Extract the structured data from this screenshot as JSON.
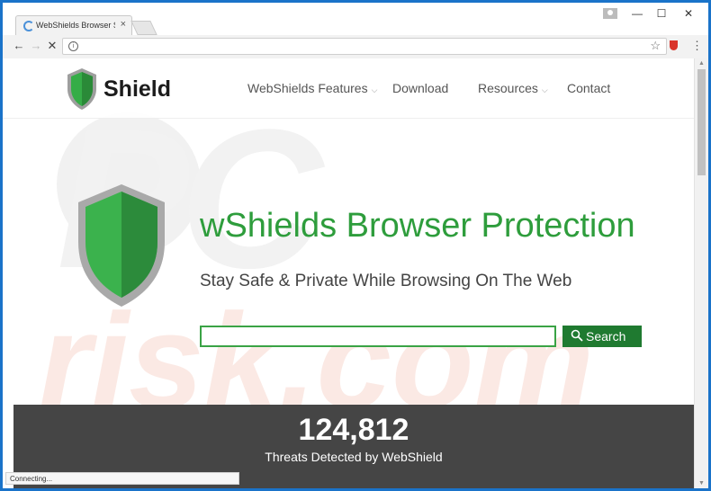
{
  "browser": {
    "tab_title": "WebShields Browser Sec",
    "tab_close": "×",
    "window_controls": {
      "minimize": "—",
      "maximize": "☐",
      "close": "✕"
    },
    "nav": {
      "back": "←",
      "forward": "→",
      "reload": "✕"
    },
    "info_icon_glyph": "i",
    "star_glyph": "☆",
    "menu_glyph": "⋮",
    "status_text": "Connecting..."
  },
  "site": {
    "logo_text": "Shield",
    "nav_items": [
      {
        "label": "WebShields Features",
        "has_dropdown": true,
        "caret": "⌵"
      },
      {
        "label": "Download",
        "has_dropdown": false
      },
      {
        "label": "Resources",
        "has_dropdown": true,
        "caret": "⌵"
      },
      {
        "label": "Contact",
        "has_dropdown": false
      }
    ]
  },
  "hero": {
    "title": "wShields Browser Protection",
    "subtitle": "Stay Safe & Private While Browsing On The Web",
    "search_placeholder": "",
    "search_button": "Search"
  },
  "stats": {
    "count": "124,812",
    "label": "Threats Detected by WebShield"
  },
  "colors": {
    "brand_green": "#2e9d3c",
    "button_green": "#1f7a30",
    "stats_bg": "#454545",
    "window_border": "#1a73c9"
  }
}
